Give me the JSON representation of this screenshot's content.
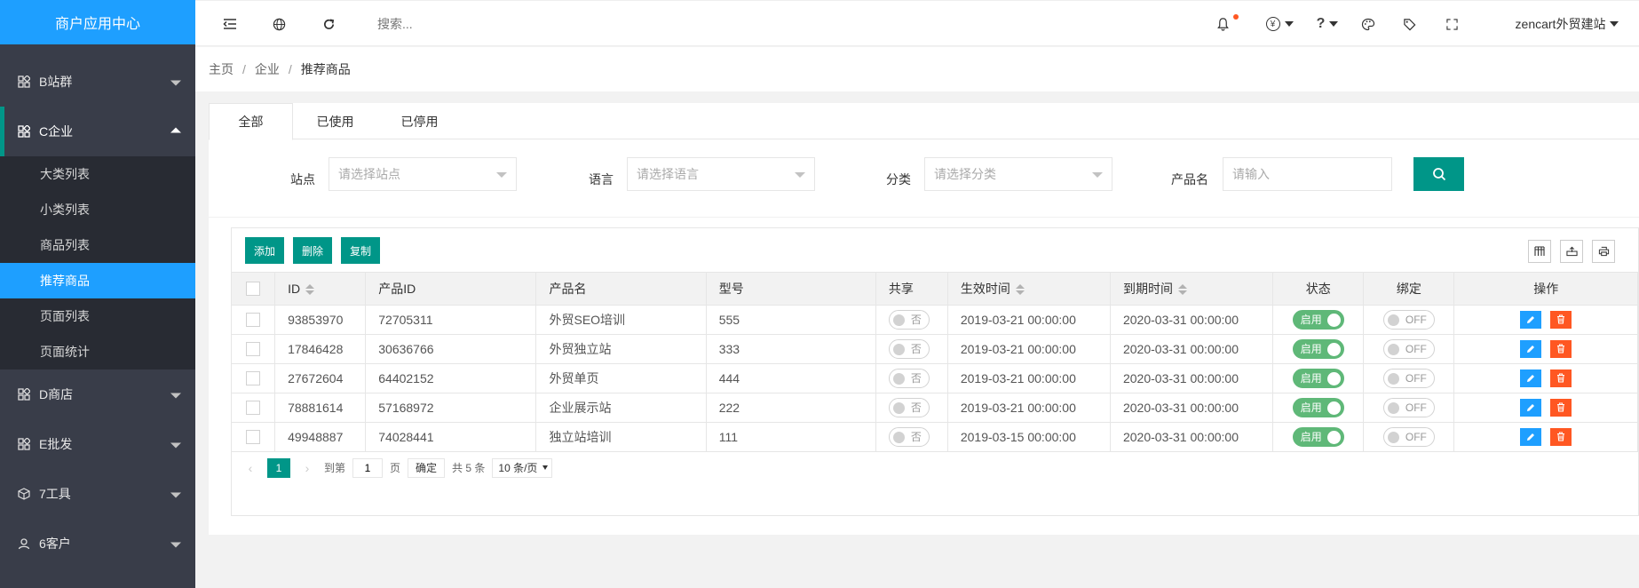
{
  "sidebar": {
    "title": "商户应用中心",
    "groups": [
      {
        "label": "B站群",
        "icon": "grid-icon"
      },
      {
        "label": "C企业",
        "icon": "grid-icon"
      },
      {
        "label": "D商店",
        "icon": "grid-icon"
      },
      {
        "label": "E批发",
        "icon": "grid-icon"
      },
      {
        "label": "7工具",
        "icon": "cube-icon"
      },
      {
        "label": "6客户",
        "icon": "user-icon"
      }
    ],
    "subitems": [
      "大类列表",
      "小类列表",
      "商品列表",
      "推荐商品",
      "页面列表",
      "页面统计"
    ],
    "active_subitem": "推荐商品"
  },
  "header": {
    "search_placeholder": "搜索...",
    "currency_symbol": "¥",
    "help_symbol": "?",
    "user_name": "zencart外贸建站"
  },
  "breadcrumb": {
    "items": [
      "主页",
      "企业",
      "推荐商品"
    ],
    "separator": "/"
  },
  "tabs": [
    "全部",
    "已使用",
    "已停用"
  ],
  "filters": {
    "site_label": "站点",
    "site_placeholder": "请选择站点",
    "lang_label": "语言",
    "lang_placeholder": "请选择语言",
    "cat_label": "分类",
    "cat_placeholder": "请选择分类",
    "name_label": "产品名",
    "name_placeholder": "请输入"
  },
  "toolbar": {
    "add_label": "添加",
    "delete_label": "删除",
    "copy_label": "复制"
  },
  "table": {
    "columns": [
      "ID",
      "产品ID",
      "产品名",
      "型号",
      "共享",
      "生效时间",
      "到期时间",
      "状态",
      "绑定",
      "操作"
    ],
    "rows": [
      {
        "id": "93853970",
        "pid": "72705311",
        "name": "外贸SEO培训",
        "model": "555",
        "share": "否",
        "start": "2019-03-21 00:00:00",
        "end": "2020-03-31 00:00:00",
        "status": "启用",
        "bind": "OFF"
      },
      {
        "id": "17846428",
        "pid": "30636766",
        "name": "外贸独立站",
        "model": "333",
        "share": "否",
        "start": "2019-03-21 00:00:00",
        "end": "2020-03-31 00:00:00",
        "status": "启用",
        "bind": "OFF"
      },
      {
        "id": "27672604",
        "pid": "64402152",
        "name": "外贸单页",
        "model": "444",
        "share": "否",
        "start": "2019-03-21 00:00:00",
        "end": "2020-03-31 00:00:00",
        "status": "启用",
        "bind": "OFF"
      },
      {
        "id": "78881614",
        "pid": "57168972",
        "name": "企业展示站",
        "model": "222",
        "share": "否",
        "start": "2019-03-21 00:00:00",
        "end": "2020-03-31 00:00:00",
        "status": "启用",
        "bind": "OFF"
      },
      {
        "id": "49948887",
        "pid": "74028441",
        "name": "独立站培训",
        "model": "111",
        "share": "否",
        "start": "2019-03-15 00:00:00",
        "end": "2020-03-31 00:00:00",
        "status": "启用",
        "bind": "OFF"
      }
    ]
  },
  "pager": {
    "current_page": "1",
    "goto_label": "到第",
    "goto_value": "1",
    "page_unit": "页",
    "ok_label": "确定",
    "total_text": "共 5 条",
    "page_size": "10 条/页"
  },
  "colors": {
    "accent_blue": "#1e9fff",
    "accent_green": "#009688",
    "sidebar_bg": "#393d49",
    "switch_on": "#5fb878",
    "delete_red": "#ff5722"
  }
}
